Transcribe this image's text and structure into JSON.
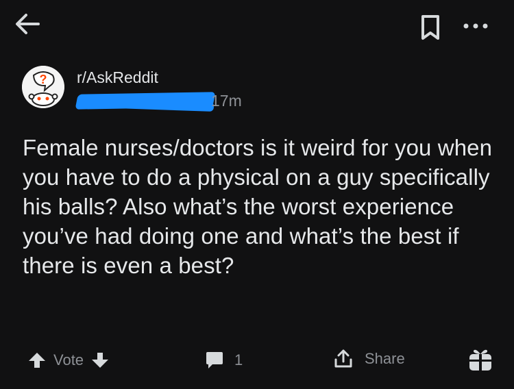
{
  "post": {
    "subreddit": "r/AskReddit",
    "age": "17m",
    "title": "Female nurses/doctors is it weird for you when you have to do a physical on a guy specifically his balls? Also what’s the worst experience you’ve had doing one and what’s the best if there is even a best?"
  },
  "actions": {
    "vote_label": "Vote",
    "comments_count": "1",
    "share_label": "Share"
  },
  "icons": {
    "back": "arrow-left-icon",
    "bookmark": "bookmark-icon",
    "more": "more-horizontal-icon",
    "upvote": "arrow-up-icon",
    "downvote": "arrow-down-icon",
    "comment": "comment-bubble-icon",
    "share": "share-upload-icon",
    "award": "gift-icon"
  },
  "colors": {
    "background": "#111112",
    "text": "#e6e8ea",
    "muted": "#8e9196",
    "redaction": "#1a8cff",
    "snoo_question": "#ff4500"
  }
}
